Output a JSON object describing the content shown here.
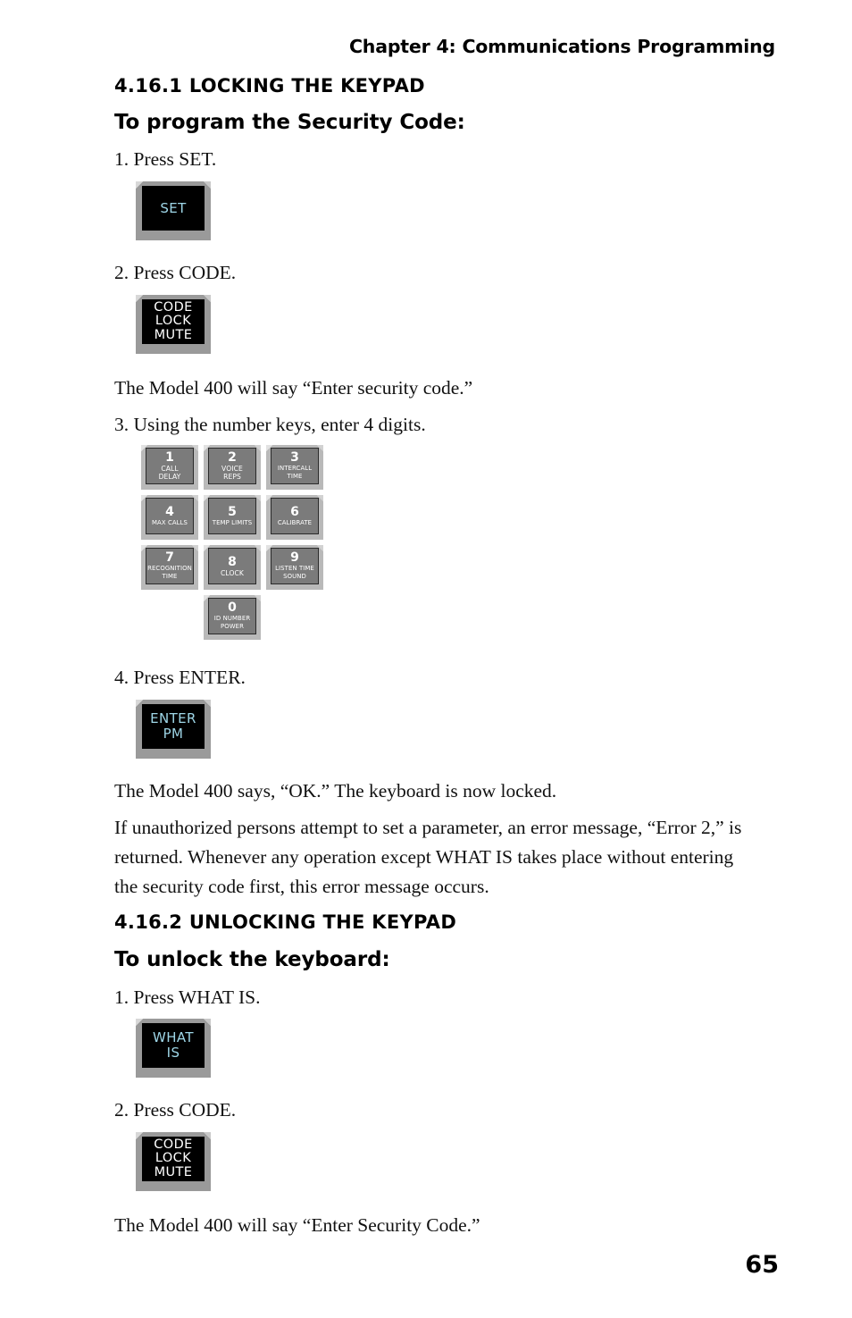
{
  "running_head": "Chapter 4: Communications Programming",
  "page_number": "65",
  "sections": [
    {
      "number_title": "4.16.1 LOCKING THE KEYPAD",
      "subtitle": "To program the Security Code:"
    },
    {
      "number_title": "4.16.2 UNLOCKING THE KEYPAD",
      "subtitle": "To unlock the keyboard:"
    }
  ],
  "steps": {
    "s1_press_set": "1. Press SET.",
    "s2_press_code": "2. Press CODE.",
    "say_enter_security_code_lower": "The Model 400 will say “Enter security code.”",
    "s3_using_number_keys": "3. Using the number keys, enter 4 digits.",
    "s4_press_enter": "4. Press ENTER.",
    "says_ok_locked": "The Model 400 says, “OK.” The keyboard is now locked.",
    "error_paragraph": "If unauthorized persons attempt to set a parameter, an error message, “Error 2,” is returned. Whenever any operation except WHAT IS takes place without entering the security code first, this error message occurs.",
    "u1_press_what_is": "1. Press WHAT IS.",
    "u2_press_code": "2. Press CODE.",
    "say_enter_security_code_upper": "The Model 400 will say “Enter Security Code.”"
  },
  "keys": {
    "set": {
      "lines": [
        "SET"
      ],
      "color": "cyan"
    },
    "code_lock_mute": {
      "lines": [
        "CODE",
        "LOCK",
        "MUTE"
      ],
      "color": "white"
    },
    "enter_pm": {
      "lines": [
        "ENTER",
        "PM"
      ],
      "color": "cyan"
    },
    "what_is": {
      "lines": [
        "WHAT",
        "IS"
      ],
      "color": "cyan"
    },
    "code_lock_mute_2": {
      "lines": [
        "CODE",
        "LOCK",
        "MUTE"
      ],
      "color": "white"
    }
  },
  "keypad": {
    "keys": [
      {
        "digit": "1",
        "labels": [
          "CALL",
          "DELAY"
        ]
      },
      {
        "digit": "2",
        "labels": [
          "VOICE",
          "REPS"
        ]
      },
      {
        "digit": "3",
        "labels": [
          "INTERCALL",
          "TIME"
        ]
      },
      {
        "digit": "4",
        "labels": [
          "MAX CALLS"
        ]
      },
      {
        "digit": "5",
        "labels": [
          "TEMP LIMITS"
        ]
      },
      {
        "digit": "6",
        "labels": [
          "CALIBRATE"
        ]
      },
      {
        "digit": "7",
        "labels": [
          "RECOGNITION",
          "TIME"
        ]
      },
      {
        "digit": "8",
        "labels": [
          "CLOCK"
        ]
      },
      {
        "digit": "9",
        "labels": [
          "LISTEN TIME",
          "SOUND"
        ]
      },
      {
        "digit": "0",
        "labels": [
          "ID NUMBER",
          "POWER"
        ]
      }
    ]
  },
  "colors": {
    "key_text_cyan": "#9ed6e7",
    "key_text_white": "#ffffff",
    "key_face_black": "#000000",
    "key_face_gray": "#7b7b7b",
    "bezel_gray": "#b9b9b9"
  }
}
